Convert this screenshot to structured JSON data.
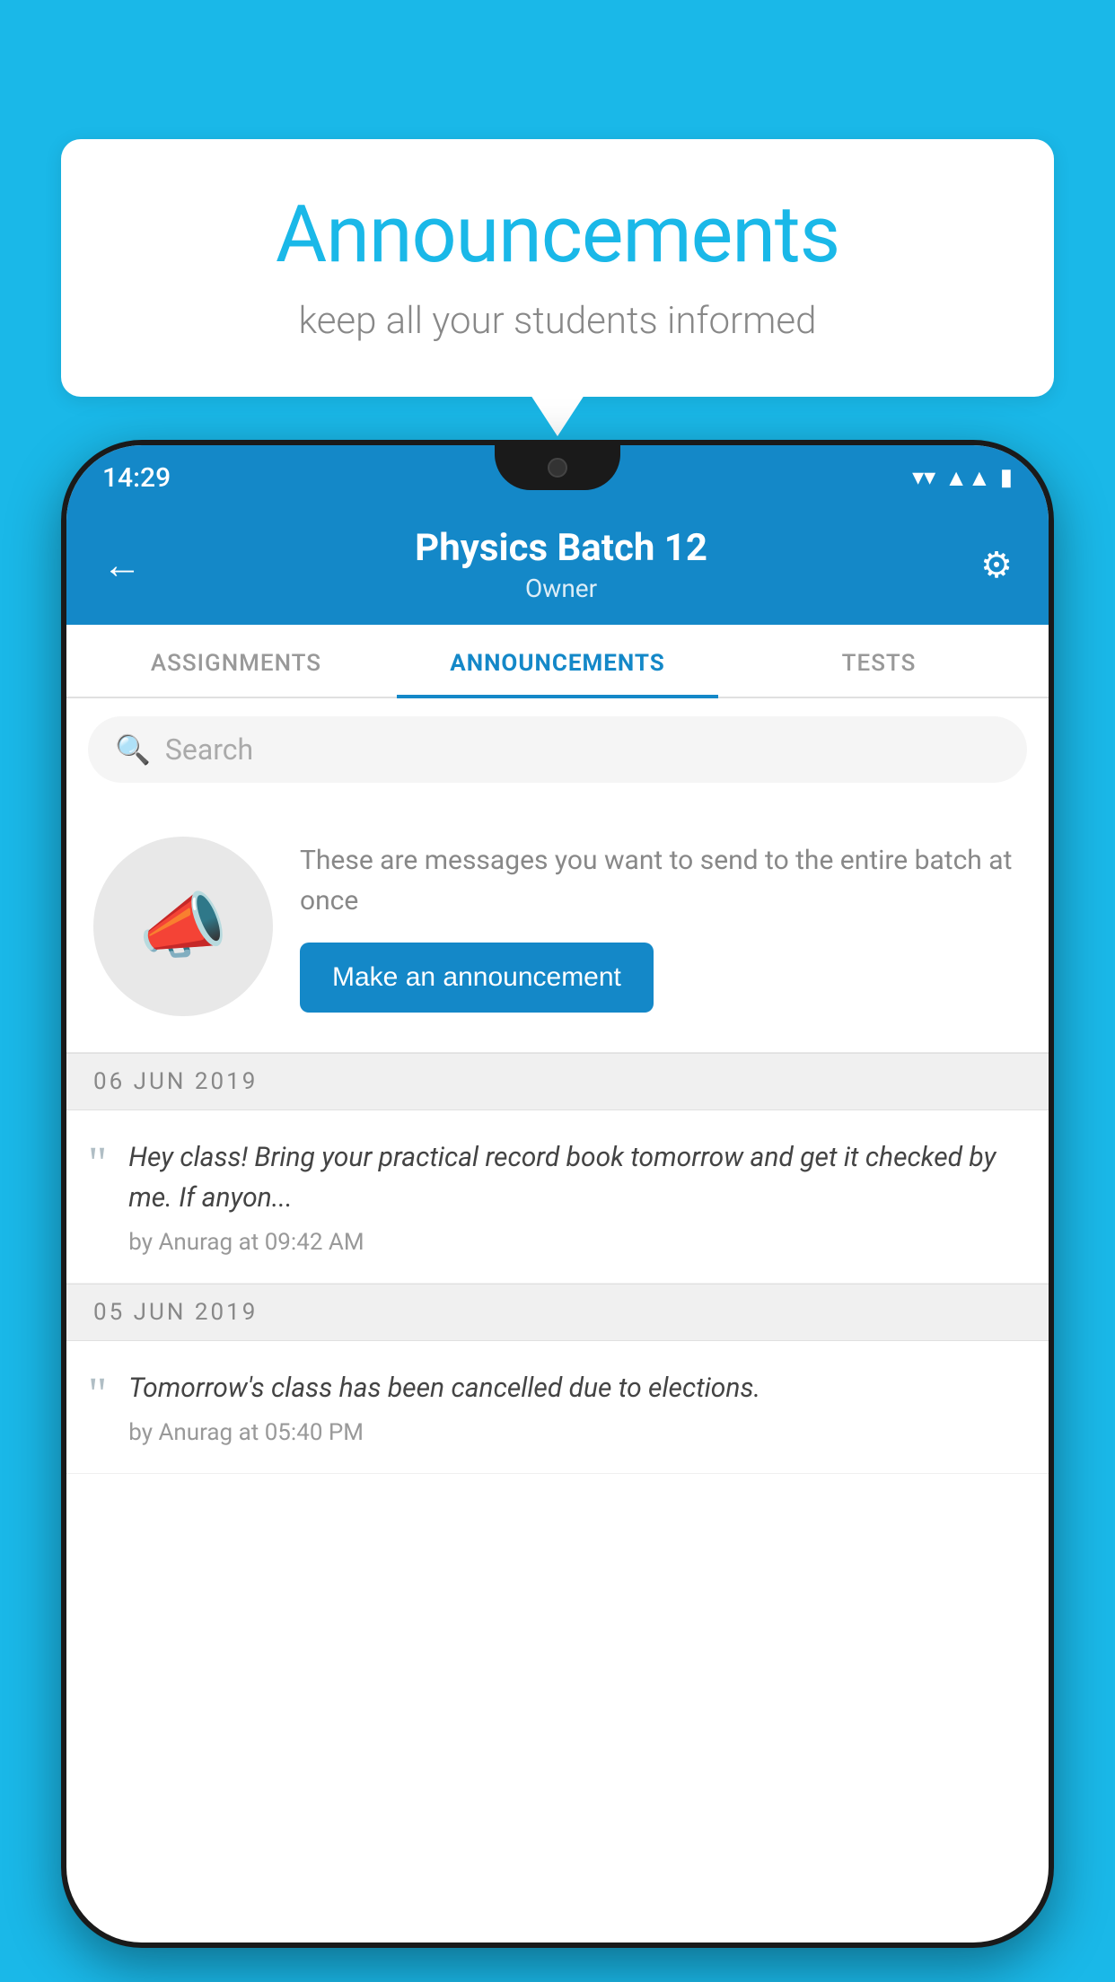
{
  "background_color": "#1ab8e8",
  "speech_bubble": {
    "title": "Announcements",
    "subtitle": "keep all your students informed"
  },
  "phone": {
    "status_bar": {
      "time": "14:29",
      "wifi": "▼",
      "signal": "▲",
      "battery": "▮"
    },
    "header": {
      "title": "Physics Batch 12",
      "subtitle": "Owner",
      "back_label": "←",
      "settings_label": "⚙"
    },
    "tabs": [
      {
        "label": "ASSIGNMENTS",
        "active": false
      },
      {
        "label": "ANNOUNCEMENTS",
        "active": true
      },
      {
        "label": "TESTS",
        "active": false
      }
    ],
    "search": {
      "placeholder": "Search"
    },
    "promo": {
      "description": "These are messages you want to send to the entire batch at once",
      "button_label": "Make an announcement"
    },
    "announcements": [
      {
        "date": "06  JUN  2019",
        "text": "Hey class! Bring your practical record book tomorrow and get it checked by me. If anyon...",
        "author": "by Anurag at 09:42 AM"
      },
      {
        "date": "05  JUN  2019",
        "text": "Tomorrow's class has been cancelled due to elections.",
        "author": "by Anurag at 05:40 PM"
      }
    ]
  }
}
